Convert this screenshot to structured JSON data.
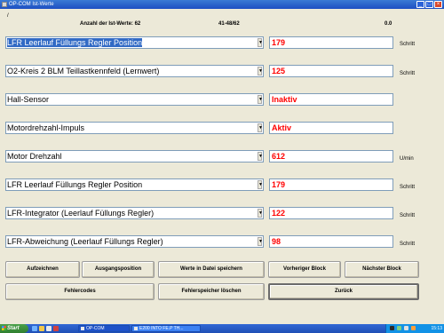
{
  "window": {
    "title": "OP-COM Ist-Werte"
  },
  "header": {
    "slash": "/",
    "count_label": "Anzahl der Ist-Werte: 62",
    "range": "41-48/62",
    "value": "0.0"
  },
  "rows": [
    {
      "param": "LFR Leerlauf Füllungs Regler Position",
      "value": "179",
      "unit": "Schritt",
      "selected": true
    },
    {
      "param": "O2-Kreis 2 BLM Teillastkennfeld (Lernwert)",
      "value": "125",
      "unit": "Schritt",
      "selected": false
    },
    {
      "param": "Hall-Sensor",
      "value": "Inaktiv",
      "unit": "",
      "selected": false
    },
    {
      "param": "Motordrehzahl-Impuls",
      "value": "Aktiv",
      "unit": "",
      "selected": false
    },
    {
      "param": "Motor Drehzahl",
      "value": "612",
      "unit": "U/min",
      "selected": false
    },
    {
      "param": "LFR Leerlauf Füllungs Regler Position",
      "value": "179",
      "unit": "Schritt",
      "selected": false
    },
    {
      "param": "LFR-Integrator (Leerlauf Füllungs Regler)",
      "value": "122",
      "unit": "Schritt",
      "selected": false
    },
    {
      "param": "LFR-Abweichung (Leerlauf Füllungs Regler)",
      "value": "98",
      "unit": "Schritt",
      "selected": false
    }
  ],
  "buttons": {
    "record": "Aufzeichnen",
    "start_position": "Ausgangsposition",
    "save_to_file": "Werte in Datei speichern",
    "prev_block": "Vorheriger Block",
    "next_block": "Nächster Block",
    "fault_codes": "Fehlercodes",
    "clear_memory": "Fehlerspeicher löschen",
    "back": "Zurück"
  },
  "taskbar": {
    "start": "Start",
    "tasks": [
      "OP-COM",
      "E200 INTO FE.P TH..."
    ],
    "clock": "15:13"
  },
  "colors": {
    "value_text": "#ff0000",
    "selection": "#316ac5",
    "dialog_bg": "#ece9d8"
  }
}
